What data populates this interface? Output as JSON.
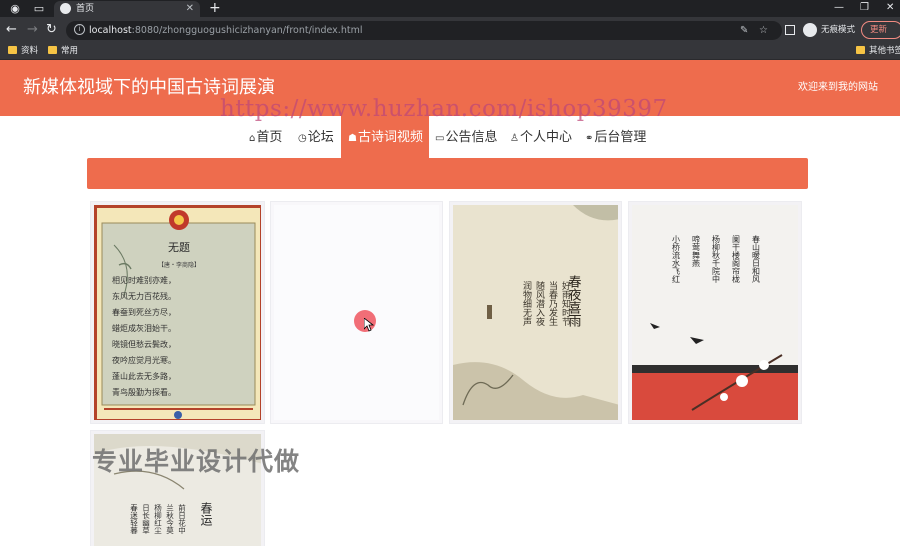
{
  "browser": {
    "tab_title": "首页",
    "url_host": "localhost",
    "url_rest": ":8080/zhongguogushicizhanyan/front/index.html",
    "profile_label": "无痕模式",
    "update_label": "更新",
    "bookmarks": [
      "资料",
      "常用"
    ],
    "other_bookmarks": "其他书签"
  },
  "header": {
    "title": "新媒体视域下的中国古诗词展演",
    "welcome": "欢迎来到我的网站"
  },
  "nav": {
    "items": [
      {
        "icon": "home-icon",
        "label": "首页"
      },
      {
        "icon": "forum-icon",
        "label": "论坛"
      },
      {
        "icon": "video-icon",
        "label": "古诗词视频"
      },
      {
        "icon": "notice-icon",
        "label": "公告信息"
      },
      {
        "icon": "user-icon",
        "label": "个人中心"
      },
      {
        "icon": "link-icon",
        "label": "后台管理"
      }
    ],
    "active": "古诗词视频"
  },
  "watermark": "https://www.huzhan.com/ishop39397",
  "promo": "专业毕业设计代做",
  "cards": {
    "card1": {
      "title": "无题",
      "author": "【唐・李商隐】",
      "lines": [
        "相见时难别亦难，",
        "东风无力百花残。",
        "春蚕到死丝方尽，",
        "蜡炬成灰泪始干。",
        "晓镜但愁云鬓改，",
        "夜吟应觉月光寒。",
        "蓬山此去无多路，",
        "青鸟殷勤为探看。"
      ]
    },
    "card3": {
      "title": "春夜喜雨",
      "cols": [
        "好雨知时节",
        "当春乃发生",
        "随风潜入夜",
        "润物细无声"
      ]
    },
    "card4": {
      "cols": [
        "春山暖日和风",
        "阑干楼阁帘栊",
        "杨柳秋千院中",
        "啼莺舞燕",
        "小桥流水飞红"
      ]
    },
    "card5": {
      "title": "春运",
      "cols": [
        "前日花中",
        "兰秋今莫",
        "杨柳红尘",
        "日长幽草",
        "春迷轻暮"
      ]
    }
  },
  "colors": {
    "brand": "#ee6c4d",
    "header_text": "#ffffff",
    "nav_text": "#333333"
  }
}
